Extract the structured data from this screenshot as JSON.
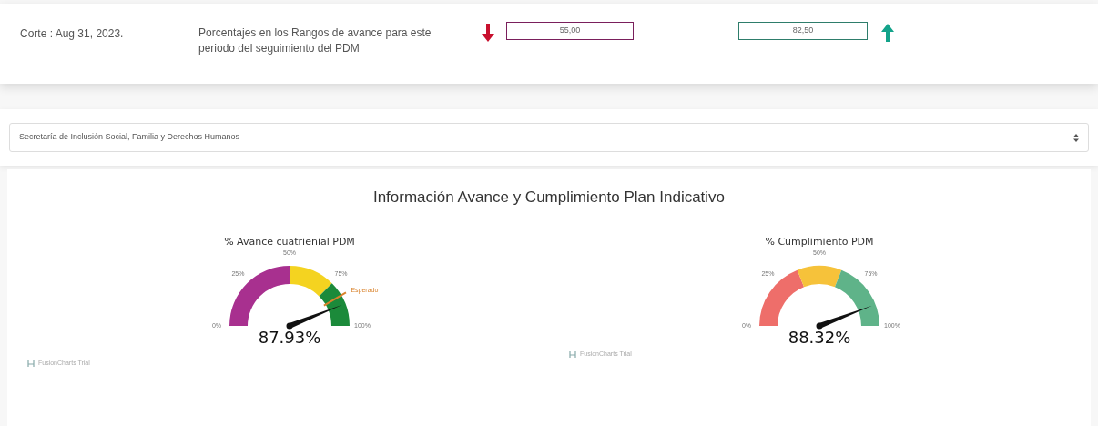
{
  "header": {
    "cutoff": "Corte : Aug 31, 2023.",
    "description": "Porcentajes en los Rangos de avance para este periodo del seguimiento del PDM",
    "low_value": "55,00",
    "high_value": "82,50"
  },
  "filter": {
    "value": "Secretaría de Inclusión Social, Familia y Derechos Humanos"
  },
  "panel": {
    "title": "Información Avance y Cumplimiento Plan Indicativo",
    "gauges": [
      {
        "title": "% Avance cuatrienial PDM",
        "value": "87.93%",
        "ticks": [
          "0%",
          "25%",
          "50%",
          "75%",
          "100%"
        ],
        "bands": [
          {
            "color": "#a8308f"
          },
          {
            "color": "#f4d320"
          },
          {
            "color": "#1b8a3a"
          }
        ],
        "expected": {
          "label": "Esperado"
        },
        "credit": "FusionCharts Trial"
      },
      {
        "title": "% Cumplimiento PDM",
        "value": "88.32%",
        "ticks": [
          "0%",
          "25%",
          "50%",
          "75%",
          "100%"
        ],
        "bands": [
          {
            "color": "#ee6e6a"
          },
          {
            "color": "#f6c23a"
          },
          {
            "color": "#5fb389"
          }
        ],
        "credit": "FusionCharts Trial"
      }
    ]
  }
}
